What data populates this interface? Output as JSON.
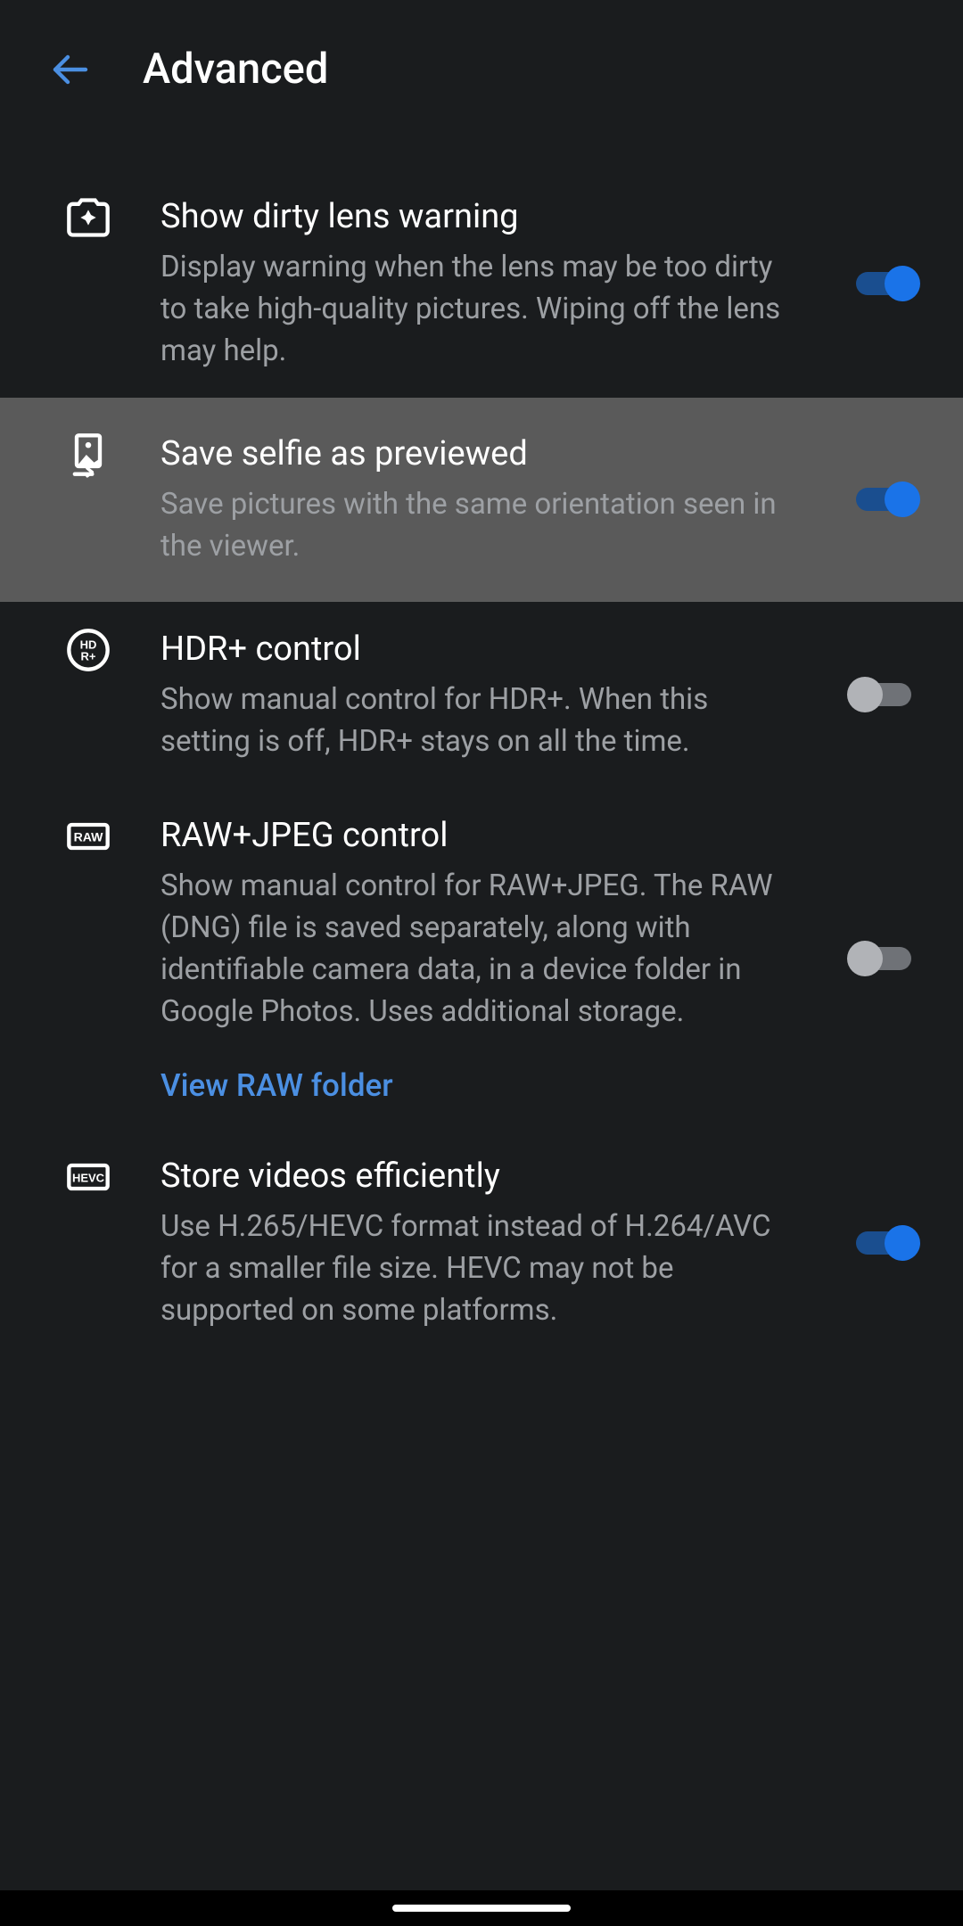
{
  "header": {
    "title": "Advanced"
  },
  "settings": [
    {
      "icon": "dirty-lens-icon",
      "title": "Show dirty lens warning",
      "description": "Display warning when the lens may be too dirty to take high-quality pictures. Wiping off the lens may help.",
      "toggle": true,
      "highlighted": false
    },
    {
      "icon": "selfie-orientation-icon",
      "title": "Save selfie as previewed",
      "description": "Save pictures with the same orientation seen in the viewer.",
      "toggle": true,
      "highlighted": true
    },
    {
      "icon": "hdr-plus-icon",
      "title": "HDR+ control",
      "description": "Show manual control for HDR+. When this setting is off, HDR+ stays on all the time.",
      "toggle": false,
      "highlighted": false
    },
    {
      "icon": "raw-icon",
      "title": "RAW+JPEG control",
      "description": "Show manual control for RAW+JPEG. The RAW (DNG) file is saved separately, along with identifiable camera data, in a device folder in Google Photos. Uses additional storage.",
      "link": "View RAW folder",
      "toggle": false,
      "highlighted": false
    },
    {
      "icon": "hevc-icon",
      "title": "Store videos efficiently",
      "description": "Use H.265/HEVC format instead of H.264/AVC for a smaller file size. HEVC may not be supported on some platforms.",
      "toggle": true,
      "highlighted": false
    }
  ]
}
